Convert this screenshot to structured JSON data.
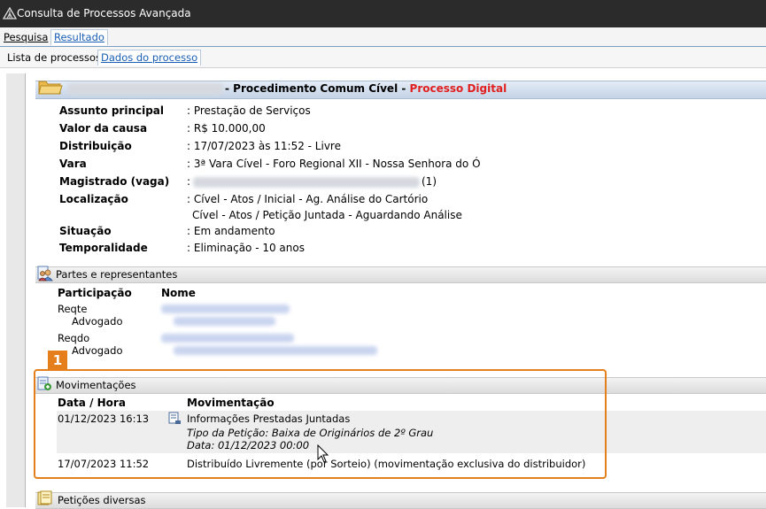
{
  "window": {
    "title": "Consulta de Processos Avançada"
  },
  "menu": {
    "tabs": [
      {
        "label": "Pesquisa"
      },
      {
        "label": "Resultado"
      }
    ]
  },
  "subtabs": [
    {
      "label": "Lista de processos"
    },
    {
      "label": "Dados do processo"
    }
  ],
  "process": {
    "class_text": "- Procedimento Comum Cível -",
    "digital_text": "Processo Digital",
    "fields": [
      {
        "label": "Assunto principal",
        "value": ": Prestação de Serviços"
      },
      {
        "label": "Valor da causa",
        "value": ": R$ 10.000,00"
      },
      {
        "label": "Distribuição",
        "value": ": 17/07/2023 às 11:52 - Livre"
      },
      {
        "label": "Vara",
        "value": ": 3ª Vara Cível - Foro Regional XII - Nossa Senhora do Ó"
      },
      {
        "label": "Magistrado (vaga)",
        "value": ":",
        "suffix": "(1)"
      },
      {
        "label": "Localização",
        "value": ": Cível - Atos / Inicial - Ag. Análise do Cartório",
        "value2": "Cível - Atos / Petição Juntada - Aguardando Análise"
      },
      {
        "label": "Situação",
        "value": ": Em andamento"
      },
      {
        "label": "Temporalidade",
        "value": ": Eliminação - 10 anos"
      }
    ]
  },
  "parties": {
    "section_title": "Partes e representantes",
    "col_participacao": "Participação",
    "col_nome": "Nome",
    "rows": [
      {
        "role": "Reqte",
        "sub": "Advogado"
      },
      {
        "role": "Reqdo",
        "sub": "Advogado"
      }
    ]
  },
  "movements": {
    "section_title": "Movimentações",
    "col_date": "Data / Hora",
    "col_mov": "Movimentação",
    "rows": [
      {
        "date": "01/12/2023 16:13",
        "title": "Informações Prestadas Juntadas",
        "detail1": "Tipo da Petição: Baixa de Originários de 2º Grau",
        "detail2": "Data: 01/12/2023 00:00"
      },
      {
        "date": "17/07/2023 11:52",
        "title": "Distribuído Livremente (por Sorteio) (movimentação exclusiva do distribuidor)"
      }
    ]
  },
  "petitions": {
    "section_title": "Petições diversas"
  },
  "annotation": {
    "badge": "1",
    "color": "#e57f1c"
  },
  "colors": {
    "digital": "#e02020",
    "link": "#1a5fb4"
  }
}
